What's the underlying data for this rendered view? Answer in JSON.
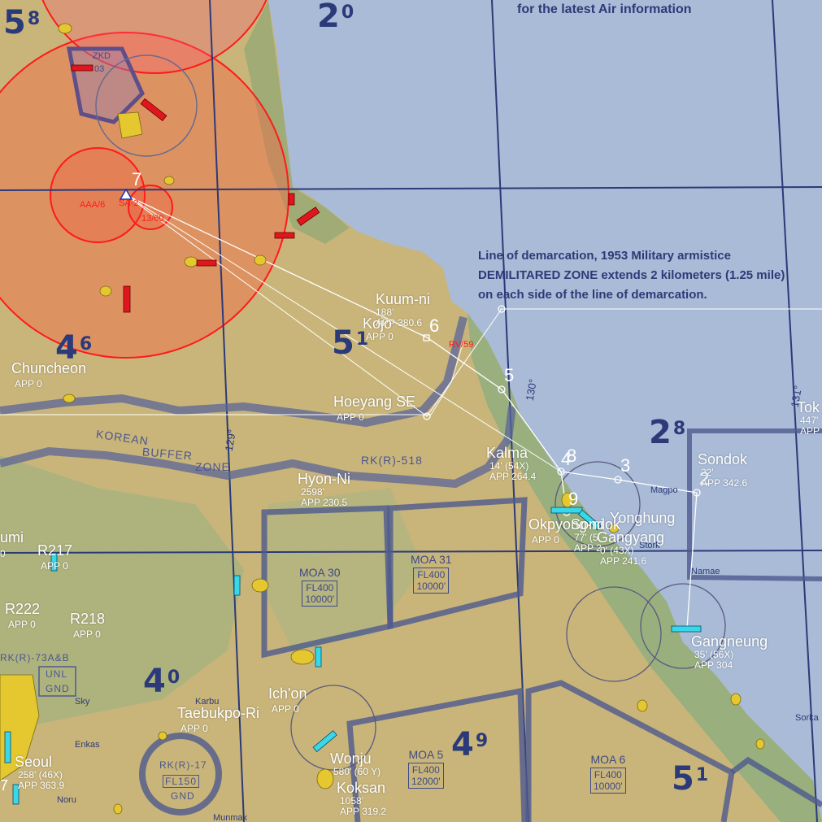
{
  "banner": "for the latest Air information",
  "notes": {
    "line1": "Line of demarcation, 1953 Military armistice",
    "line2": "DEMILITARED ZONE extends 2 kilometers (1.25 mile)",
    "line3": "on each side of the line of demarcation."
  },
  "grid": [
    {
      "id": "g58",
      "main": "5",
      "sup": "8"
    },
    {
      "id": "g20",
      "main": "2",
      "sup": "0"
    },
    {
      "id": "g46",
      "main": "4",
      "sup": "6"
    },
    {
      "id": "g51a",
      "main": "5",
      "sup": "1"
    },
    {
      "id": "g28",
      "main": "2",
      "sup": "8"
    },
    {
      "id": "g40",
      "main": "4",
      "sup": "0"
    },
    {
      "id": "g49",
      "main": "4",
      "sup": "9"
    },
    {
      "id": "g51b",
      "main": "5",
      "sup": "1"
    }
  ],
  "waypoints": {
    "w2": "2",
    "w3": "3",
    "w4": "4",
    "w5": "5",
    "w6": "6",
    "w7": "7",
    "w8": "8",
    "w9": "9"
  },
  "airfields": {
    "kuumni": {
      "name": "Kuum-ni",
      "alt": "188'",
      "app": "APP 380.6"
    },
    "kojo": {
      "name": "Kojo",
      "app": "APP 0"
    },
    "chuncheon": {
      "name": "Chuncheon",
      "app": "APP 0"
    },
    "hoeyang": {
      "name": "Hoeyang SE",
      "app": "APP 0"
    },
    "kalma": {
      "name": "Kalma",
      "alt": "14' (54X)",
      "app": "APP 264.4"
    },
    "hyonni": {
      "name": "Hyon-Ni",
      "alt": "2598'",
      "app": "APP 230.5"
    },
    "sondok": {
      "name": "Sondok",
      "alt": "22'",
      "app": "APP 342.6"
    },
    "tok": {
      "name": "Tok",
      "alt": "447'",
      "app": "APP"
    },
    "okpyong": {
      "name": "Okpyong-ni",
      "app": "APP 0"
    },
    "sondok2": {
      "name": "Sondok",
      "alt": "77' (5",
      "app": "APP 2"
    },
    "yonghung": {
      "name": "Yonghung",
      "alt": "",
      "app": ""
    },
    "gangyang": {
      "name": "Gangyang",
      "alt": "0' (43X)",
      "app": "APP 241.6"
    },
    "gangneung": {
      "name": "Gangneung",
      "alt": "35' (56X)",
      "app": "APP 304"
    },
    "umi": {
      "name": "umi",
      "app": "0"
    },
    "r217": {
      "name": "R217",
      "app": "APP 0"
    },
    "r222": {
      "name": "R222",
      "app": "APP 0"
    },
    "r218": {
      "name": "R218",
      "app": "APP 0"
    },
    "ichon": {
      "name": "Ich'on",
      "app": "APP 0"
    },
    "taebukpo": {
      "name": "Taebukpo-Ri",
      "app": "APP 0"
    },
    "seoul": {
      "name": "Seoul",
      "alt": "258' (46X)",
      "app": "APP 363.9"
    },
    "wonju": {
      "name": "Wonju",
      "alt": "580' (60 Y)"
    },
    "koksan": {
      "name": "Koksan",
      "alt": "1058'",
      "app": "APP 319.2"
    }
  },
  "threats": {
    "aaa": "AAA/6",
    "sa2": "SA-2",
    "sa13": "13/60",
    "rv": "RV/59",
    "zkd": "ZKD",
    "zkd_num": "03"
  },
  "zones": {
    "korean": "KOREAN",
    "buffer": "BUFFER",
    "zone": "ZONE",
    "rk518": "RK(R)-518",
    "rk73": "RK(R)-73A&B",
    "unl": "UNL",
    "gnd": "GND",
    "rk17": "RK(R)-17",
    "fl150": "FL150",
    "gnd2": "GND"
  },
  "moa": {
    "moa30": {
      "name": "MOA 30",
      "fl": "FL400",
      "alt": "10000'"
    },
    "moa31": {
      "name": "MOA 31",
      "fl": "FL400",
      "alt": "10000'"
    },
    "moa5": {
      "name": "MOA 5",
      "fl": "FL400",
      "alt": "12000'"
    },
    "moa6": {
      "name": "MOA 6",
      "fl": "FL400",
      "alt": "10000'"
    }
  },
  "places": {
    "magpo": "Magpo",
    "namae": "Namae",
    "sorka": "Sorka",
    "karbu": "Karbu",
    "sky": "Sky",
    "enkas": "Enkas",
    "noru": "Noru",
    "munmak": "Munmak",
    "stork": "Stork"
  },
  "meridians": {
    "m129": "129°",
    "m130": "130°",
    "m131": "131°"
  },
  "edge7": "7",
  "colors": {
    "water": "#a9bbd6",
    "land": "#c9b57a",
    "threat_ring": "#ff1a1a",
    "route": "#ffffff",
    "boundary": "#3e4a86",
    "label": "#ffffff"
  }
}
